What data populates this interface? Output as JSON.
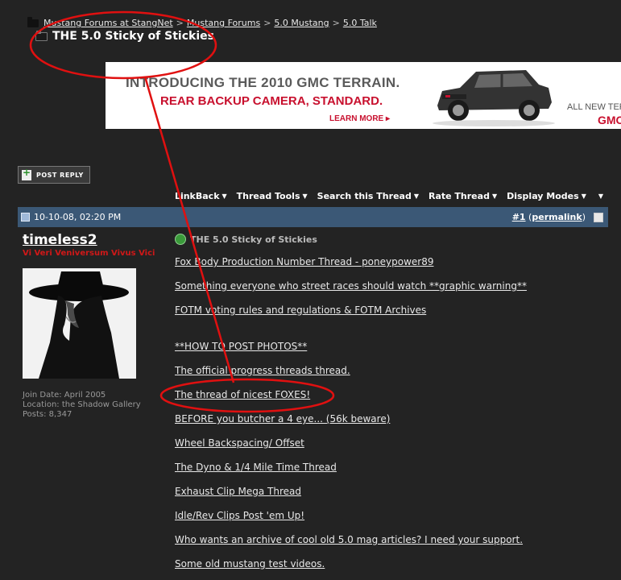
{
  "breadcrumb": {
    "items": [
      "Mustang Forums at StangNet",
      "Mustang Forums",
      "5.0 Mustang",
      "5.0 Talk"
    ],
    "separator": ">"
  },
  "thread_title": "THE 5.0 Sticky of Stickies",
  "ad": {
    "line1": "INTRODUCING THE 2010 GMC TERRAIN.",
    "line2": "REAR BACKUP CAMERA, STANDARD.",
    "learn_more": "LEARN MORE ▸",
    "all_new": "ALL NEW TER",
    "brand": "GMC",
    "colors": {
      "gray": "#5a5a5a",
      "red": "#c8102e"
    }
  },
  "post_reply_label": "POST REPLY",
  "toolbar": [
    "LinkBack",
    "Thread Tools",
    "Search this Thread",
    "Rate Thread",
    "Display Modes"
  ],
  "post": {
    "date": "10-10-08, 02:20 PM",
    "number_prefix": "#",
    "number": "1",
    "permalink": "permalink",
    "title": "THE 5.0 Sticky of Stickies",
    "links": [
      "Fox Body Production Number Thread - poneypower89",
      "Something everyone who street races should watch **graphic warning**",
      "FOTM voting rules and regulations & FOTM Archives",
      "**HOW TO POST PHOTOS**",
      "The official progress threads thread.",
      "The thread of nicest FOXES!",
      "BEFORE you butcher a 4 eye... (56k beware)",
      "Wheel Backspacing/ Offset",
      "The Dyno & 1/4 Mile Time Thread",
      "Exhaust Clip Mega Thread",
      "Idle/Rev Clips Post 'em Up!",
      "Who wants an archive of cool old 5.0 mag articles? I need your support.",
      "Some old mustang test videos."
    ]
  },
  "user": {
    "name": "timeless2",
    "title": "Vi Veri Veniversum Vivus Vici",
    "join_date": "Join Date: April 2005",
    "location": "Location: the Shadow Gallery",
    "posts": "Posts: 8,347"
  },
  "colors": {
    "header_bar": "#3b5876",
    "background": "#232323",
    "annotation": "#e01010"
  }
}
